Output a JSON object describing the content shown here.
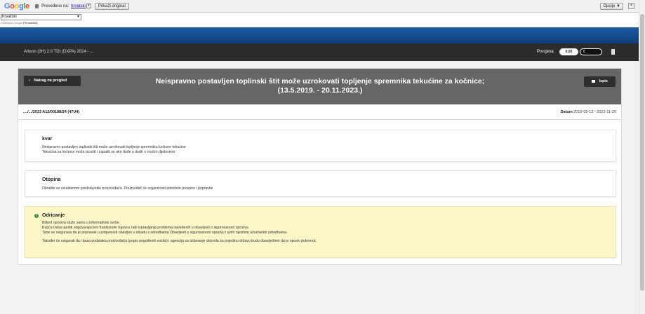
{
  "translate_bar": {
    "translated_to_label": "Prevedeno na:",
    "language": "hrvatski",
    "show_original": "Prikaži original",
    "options": "Opcije ▼",
    "close": "×",
    "select_value": "hrvatski",
    "powered_prefix": "Podržava",
    "powered_brand": "Google",
    "powered_product": "Prevoditelj"
  },
  "vehicle_bar": {
    "vehicle": "Arteon (3H) 2.0 TDI (DXPA) 2024 - ...",
    "estimate_label": "Procjena",
    "estimate_value": "0,00",
    "currency": "€"
  },
  "panel": {
    "back_label": "Natrag na pregled",
    "print_label": "Ispis",
    "title_line1": "Neispravno postavljen toplinski štit može uzrokovati topljenje spremnika tekućine za kočnice;",
    "title_line2": "(13.5.2019. - 20.11.2023.)",
    "reference": "..../.../2023 A12/00188/24 (47U4)",
    "date_label": "Datum",
    "date_value": "2019-05-13 - 2023-11-20"
  },
  "fault": {
    "heading": "kvar",
    "line1": "Neispravno postavljen toplinski štit može uzrokovati topljenje spremnika kočione tekućine",
    "line2": "Tekućina za kočnice može iscuriti i zapaliti se ako dođe u dodir s vrućim dijelovima"
  },
  "solution": {
    "heading": "Otopina",
    "line1": "Obratite se ovlaštenom predstavniku proizvođača. Proizvođač će organizirati potrebne provjere i popravke"
  },
  "disclaimer": {
    "heading": "Odricanje",
    "line1": "BiltenI opoziva služe samo u informativne svrhe.",
    "line2": "Kupca treba uputiti odgovarajućem franšiznom trgovcu radi ispravljanja problema navedenih u obavijesti o sigurnosnom opozivu.",
    "line3": "Time se osigurava da je popravak u potpunosti obavljen u skladu s odredbama Obavijesti o sigurnosnom opozivu i svim njezinim ažuriranim odredbama.",
    "line4": "Također će osigurati da i baza podataka proizvođača (popis pogođenih vozila) i agencija za izdavanje dozvola za pojedinu državu budu obaviješteni da je opoziv pokrenut."
  },
  "colors": {
    "blue_header": "#1a5ba3",
    "dark_bar": "#2c2c2c",
    "panel_head": "#666666",
    "disclaimer_bg": "#fbf7c8",
    "info_icon": "#3a8f3a"
  }
}
